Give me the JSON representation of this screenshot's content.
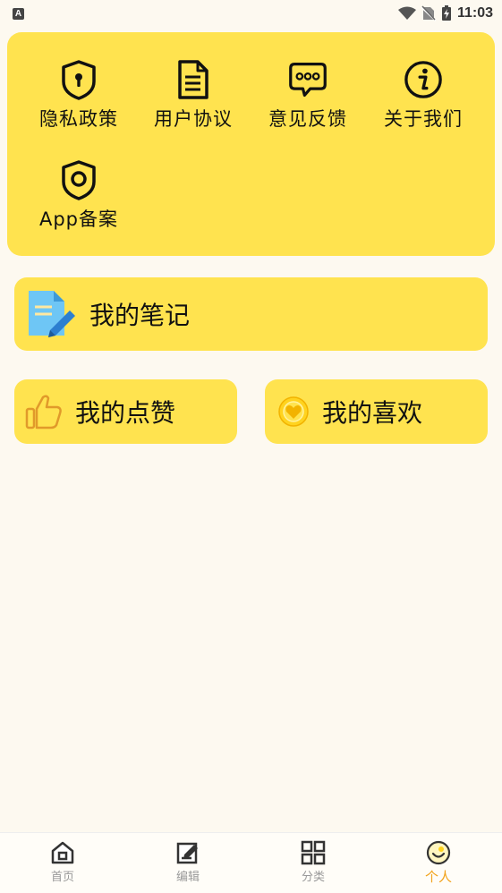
{
  "status_bar": {
    "time": "11:03",
    "notification_badge": "A"
  },
  "grid": {
    "items": [
      {
        "label": "隐私政策",
        "icon": "shield-keyhole-icon"
      },
      {
        "label": "用户协议",
        "icon": "document-icon"
      },
      {
        "label": "意见反馈",
        "icon": "chat-bubble-icon"
      },
      {
        "label": "关于我们",
        "icon": "info-circle-icon"
      },
      {
        "label": "App备案",
        "icon": "shield-ring-icon"
      }
    ]
  },
  "cards": {
    "notes": {
      "label": "我的笔记",
      "icon": "note-edit-icon"
    },
    "likes": {
      "label": "我的点赞",
      "icon": "thumbs-up-icon"
    },
    "favorites": {
      "label": "我的喜欢",
      "icon": "heart-circle-icon"
    }
  },
  "tabbar": {
    "tabs": [
      {
        "label": "首页",
        "icon": "home-icon"
      },
      {
        "label": "编辑",
        "icon": "edit-icon"
      },
      {
        "label": "分类",
        "icon": "grid-icon"
      },
      {
        "label": "个人",
        "icon": "profile-icon"
      }
    ],
    "active_index": 3
  },
  "colors": {
    "accent_yellow": "#FFE34F",
    "background": "#FDF9F0",
    "active_tab": "#F2A31C"
  }
}
